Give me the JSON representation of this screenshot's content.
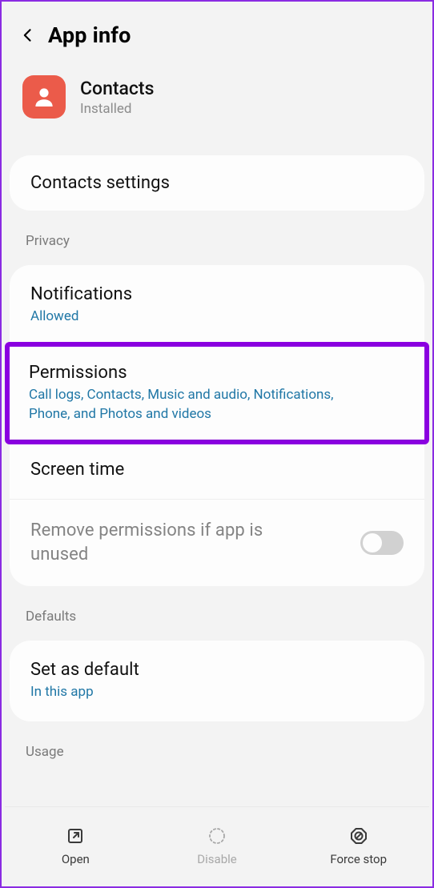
{
  "header": {
    "title": "App info"
  },
  "app": {
    "name": "Contacts",
    "status": "Installed"
  },
  "settings_item": {
    "title": "Contacts settings"
  },
  "sections": {
    "privacy_label": "Privacy",
    "defaults_label": "Defaults",
    "usage_label": "Usage"
  },
  "privacy": {
    "notifications": {
      "title": "Notifications",
      "subtitle": "Allowed"
    },
    "permissions": {
      "title": "Permissions",
      "subtitle": "Call logs, Contacts, Music and audio, Notifications, Phone, and Photos and videos"
    },
    "screen_time": {
      "title": "Screen time"
    },
    "remove_perms": {
      "title": "Remove permissions if app is unused",
      "toggle_on": false
    }
  },
  "defaults": {
    "set_as_default": {
      "title": "Set as default",
      "subtitle": "In this app"
    }
  },
  "footer": {
    "open": "Open",
    "disable": "Disable",
    "force_stop": "Force stop"
  }
}
